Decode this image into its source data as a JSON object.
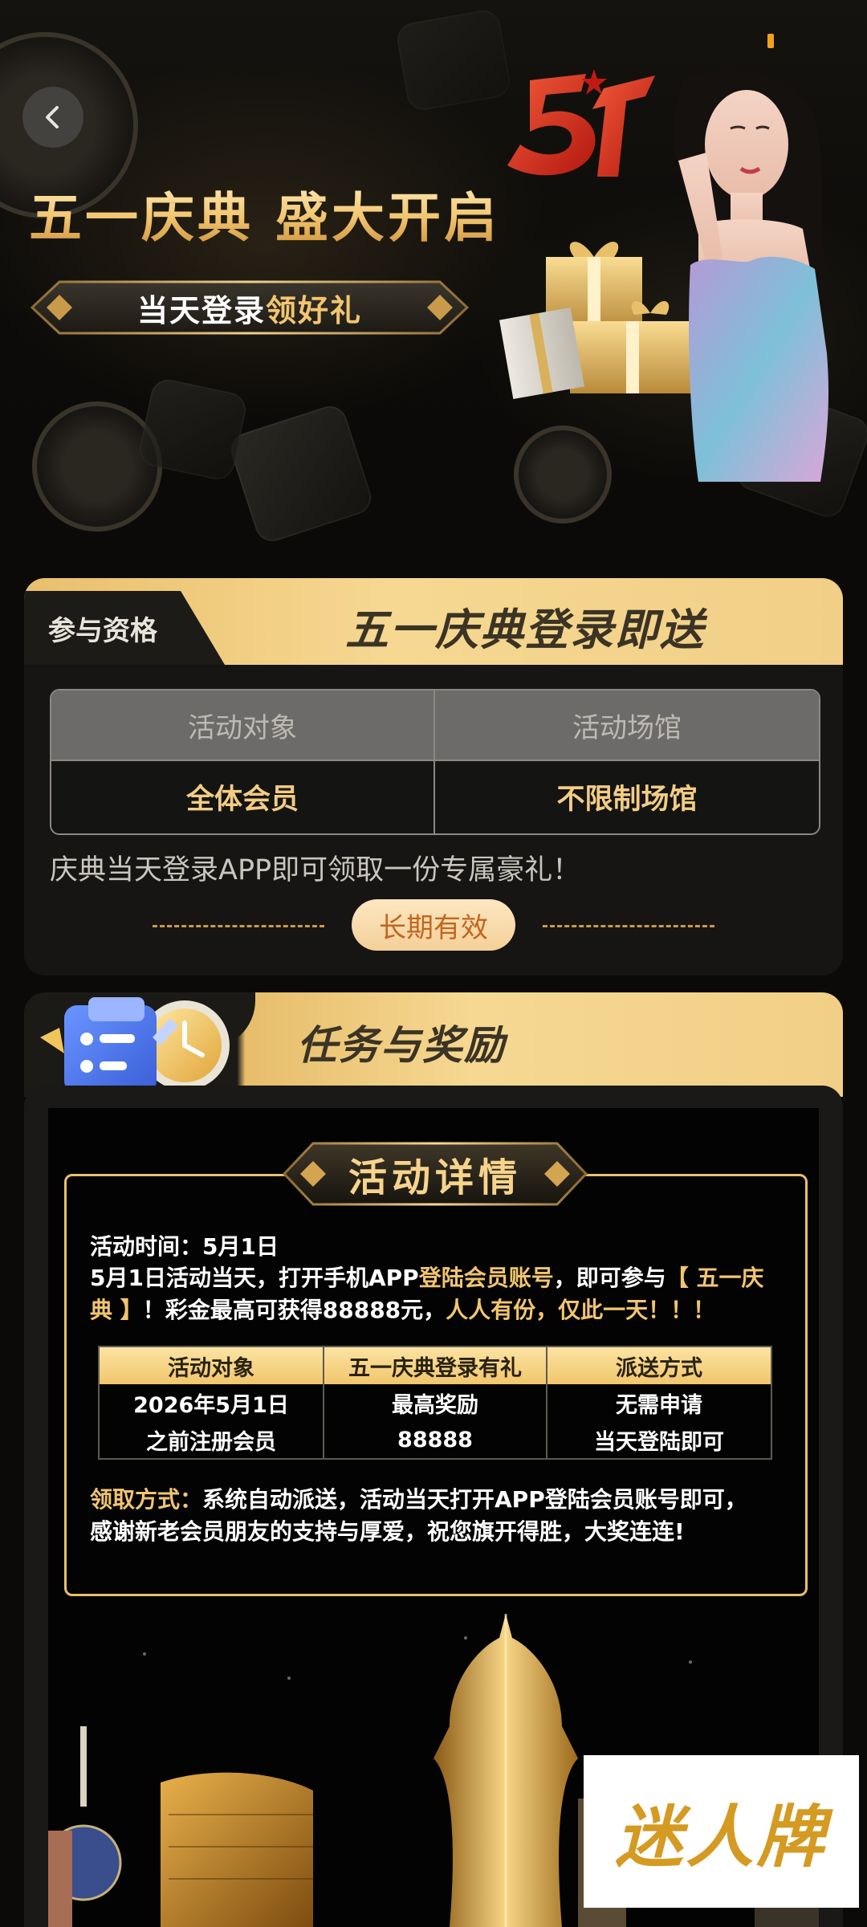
{
  "hero": {
    "title": "五一庆典 盛大开启",
    "ribbon_white": "当天登录",
    "ribbon_gold": "领好礼",
    "logo_mark": "51"
  },
  "eligibility": {
    "tab_label": "参与资格",
    "title": "五一庆典登录即送",
    "headers": [
      "活动对象",
      "活动场馆"
    ],
    "values": [
      "全体会员",
      "不限制场馆"
    ],
    "description": "庆典当天登录APP即可领取一份专属豪礼！",
    "validity": "长期有效"
  },
  "tasks": {
    "title": "任务与奖励",
    "details_badge": "活动详情",
    "time_line": "活动时间：5月1日",
    "para_part1": "5月1日活动当天，打开手机APP",
    "para_part2": "登陆会员账号",
    "para_part3": "，即可参与",
    "para_part4": "【 五一庆典 】",
    "para_part5": "！彩金最高可获得88888元，",
    "para_part6": "人人有份，仅此一天！！！",
    "table": {
      "headers": [
        "活动对象",
        "五一庆典登录有礼",
        "派送方式"
      ],
      "row1": [
        "2026年5月1日",
        "最高奖励",
        "无需申请"
      ],
      "row2": [
        "之前注册会员",
        "88888",
        "当天登陆即可"
      ]
    },
    "claim_label": "领取方式：",
    "claim_text1": "系统自动派送，活动当天打开APP登陆会员账号即可，",
    "claim_text2": "感谢新老会员朋友的支持与厚爱，祝您旗开得胜，大奖连连!"
  },
  "watermark": "迷人牌",
  "colors": {
    "gold": "#f2c56f",
    "background": "#0b0a08",
    "pill_text": "#c2651e"
  }
}
